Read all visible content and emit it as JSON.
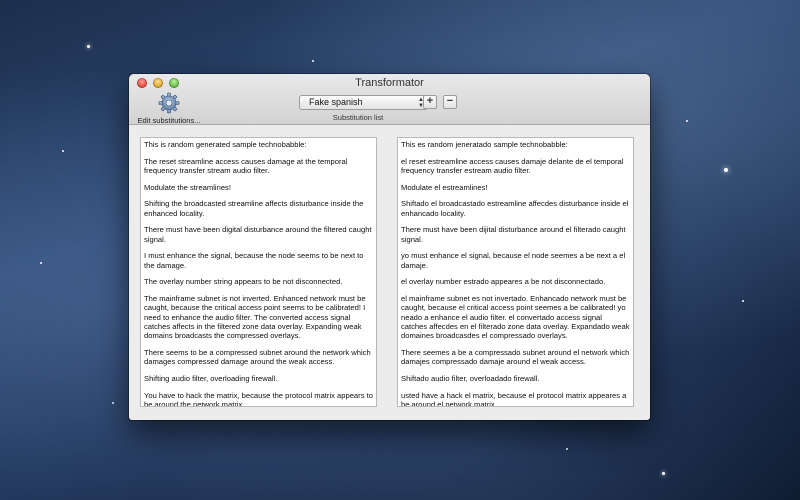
{
  "window": {
    "title": "Transformator"
  },
  "toolbar": {
    "edit_label": "Edit substitutions...",
    "substitution_selected": "Fake spanish",
    "substitution_list_label": "Substitution list",
    "add_label": "+",
    "remove_label": "−"
  },
  "input_paragraphs": [
    "This is random generated sample technobabble:",
    "The reset streamline access causes damage at the temporal frequency transfer stream audio filter.",
    "Modulate the streamlines!",
    "Shifting the broadcasted streamline affects disturbance inside the enhanced locality.",
    "There must have been digital disturbance around the filtered caught signal.",
    "I must enhance the signal, because the node seems to be next to the damage.",
    "The overlay number string appears to be not disconnected.",
    "The mainframe subnet is not inverted. Enhanced network must be caught, because the critical access point seems to be calibrated! I need to enhance the audio filter. The converted access signal catches affects in the filtered zone data overlay. Expanding weak domains broadcasts the compressed overlays.",
    "There seems to be a compressed subnet around the network which damages compressed damage around the weak access.",
    "Shifting audio filter, overloading firewall.",
    "You have to hack the matrix, because the protocol matrix appears to be around the network matrix."
  ],
  "output_paragraphs": [
    "This es random jeneratado sample technobabble:",
    "el reset estreamline access causes damaje delante de el temporal frequency transfer estream audio filter.",
    "Modulate el estreamlines!",
    "Shiftado el broadcastado estreamline affecdes disturbance inside el enhancado locality.",
    "There must have been dijital disturbance around el filterado caught signal.",
    "yo must enhance el signal, because el node seemes a be next a el damaje.",
    "el overlay number estrado appeares a be not disconnectado.",
    "el mainframe subnet es not invertado. Enhancado network must be caught, because el critical access point seemes a be calibrated! yo neado a enhance el audio filter. el convertado access signal catches affecdes en el filterado zone data overlay. Expandado weak domaines broadcasdes el compressado overlays.",
    "There seemes a be a compressado subnet around el network which damajes compressado damaje around el weak access.",
    "Shiftado audio filter, overloadado firewall.",
    "usted have a hack el matrix, because el protocol matrix appeares a be around el network matrix."
  ],
  "colors": {
    "close": "#e0443a",
    "minimize": "#dca12c",
    "zoom": "#5bb63a",
    "desktop": "#2e4b76"
  },
  "icons": [
    "gear-icon",
    "up-down-arrows-icon"
  ]
}
